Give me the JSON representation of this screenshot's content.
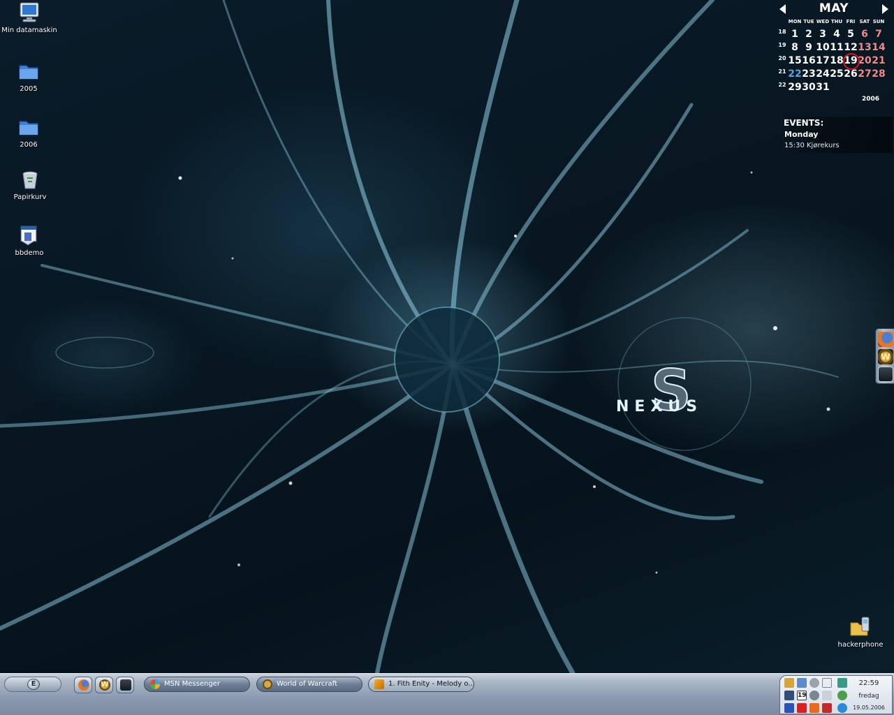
{
  "desktop": {
    "icons": [
      {
        "label": "Min datamaskin",
        "icon": "computer-icon"
      },
      {
        "label": "2005",
        "icon": "folder-icon"
      },
      {
        "label": "2006",
        "icon": "folder-icon"
      },
      {
        "label": "Papirkurv",
        "icon": "recycle-bin-icon"
      },
      {
        "label": "bbdemo",
        "icon": "program-icon"
      },
      {
        "label": "hackerphone",
        "icon": "folder-phone-icon"
      }
    ]
  },
  "wallpaper": {
    "logo_text": "Nexus",
    "accent_color": "#7fc8e0"
  },
  "calendar": {
    "month": "MAY",
    "year": "2006",
    "weekdays": [
      "MON",
      "TUE",
      "WED",
      "THU",
      "FRI",
      "SAT",
      "SUN"
    ],
    "weeks": [
      {
        "number": "18",
        "days": [
          "1",
          "2",
          "3",
          "4",
          "5",
          "6",
          "7"
        ]
      },
      {
        "number": "19",
        "days": [
          "8",
          "9",
          "10",
          "11",
          "12",
          "13",
          "14"
        ]
      },
      {
        "number": "20",
        "days": [
          "15",
          "16",
          "17",
          "18",
          "19",
          "20",
          "21"
        ]
      },
      {
        "number": "21",
        "days": [
          "22",
          "23",
          "24",
          "25",
          "26",
          "27",
          "28"
        ]
      },
      {
        "number": "22",
        "days": [
          "29",
          "30",
          "31",
          "",
          "",
          "",
          ""
        ]
      }
    ],
    "today": "19",
    "weekend_color": "#f08a8a",
    "today_ring_color": "#e0141e"
  },
  "events": {
    "title": "EVENTS:",
    "day": "Monday",
    "item": "15:30 Kjørekurs"
  },
  "side_launcher": {
    "items": [
      "firefox-icon",
      "world-of-warcraft-icon",
      "steam-icon"
    ]
  },
  "taskbar": {
    "start_glyph": "E",
    "quick_launch": [
      "firefox-icon",
      "world-of-warcraft-icon",
      "steam-icon"
    ],
    "tasks": [
      {
        "label": "MSN Messenger",
        "icon": "msn-icon",
        "active": false
      },
      {
        "label": "World of Warcraft",
        "icon": "world-of-warcraft-icon",
        "active": false
      },
      {
        "label": "1. Fith Enity - Melody o...",
        "icon": "winamp-icon",
        "active": true
      }
    ]
  },
  "tray": {
    "time": "22:59",
    "day": "fredag",
    "date": "19.05.2006"
  }
}
